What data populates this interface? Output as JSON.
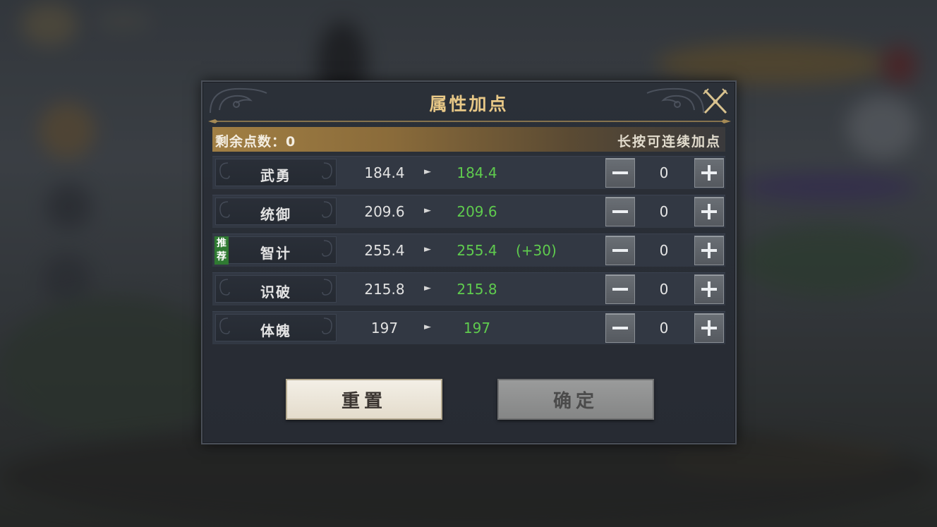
{
  "dialog": {
    "title": "属性加点",
    "close_icon": "close-crossed-swords-icon"
  },
  "points": {
    "label": "剩余点数：",
    "value": "0",
    "hint": "长按可连续加点"
  },
  "attributes": [
    {
      "name": "武勇",
      "current": "184.4",
      "new": "184.4",
      "bonus": "",
      "add": "0",
      "recommended": false
    },
    {
      "name": "统御",
      "current": "209.6",
      "new": "209.6",
      "bonus": "",
      "add": "0",
      "recommended": false
    },
    {
      "name": "智计",
      "current": "255.4",
      "new": "255.4",
      "bonus": "(+30)",
      "add": "0",
      "recommended": true,
      "badge": "推荐"
    },
    {
      "name": "识破",
      "current": "215.8",
      "new": "215.8",
      "bonus": "",
      "add": "0",
      "recommended": false
    },
    {
      "name": "体魄",
      "current": "197",
      "new": "197",
      "bonus": "",
      "add": "0",
      "recommended": false
    }
  ],
  "arrow_glyph": "►",
  "buttons": {
    "reset": "重置",
    "confirm": "确定"
  },
  "colors": {
    "title_gold": "#e8c887",
    "value_green": "#5fcb4e",
    "badge_green": "#2f7a32"
  }
}
